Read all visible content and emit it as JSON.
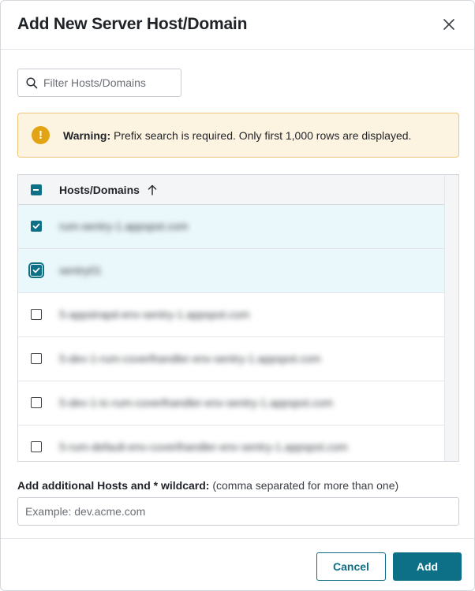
{
  "dialog": {
    "title": "Add New Server Host/Domain",
    "close_icon": "close-icon"
  },
  "filter": {
    "placeholder": "Filter Hosts/Domains",
    "icon": "search-icon"
  },
  "warning": {
    "icon": "exclamation-circle-icon",
    "label": "Warning:",
    "message": " Prefix search is required. Only first 1,000 rows are displayed."
  },
  "table": {
    "header": {
      "column": "Hosts/Domains",
      "sort_icon": "arrow-up-icon",
      "select_all_state": "indeterminate"
    },
    "rows": [
      {
        "host": "rum-sentry-1.appspot.com",
        "checked": true
      },
      {
        "host": "sentry01",
        "checked": true
      },
      {
        "host": "5-appstrapd-env-sentry-1.appspot.com",
        "checked": false
      },
      {
        "host": "5-dev-1-rum-coverlhandler-env-sentry-1.appspot.com",
        "checked": false
      },
      {
        "host": "5-dev-1-tc-rum-coverlhandler-env-sentry-1.appspot.com",
        "checked": false
      },
      {
        "host": "5-rum-default-env-coverlhandler-env-sentry-1.appspot.com",
        "checked": false
      }
    ]
  },
  "additional": {
    "label": "Add additional Hosts and * wildcard:",
    "hint": " (comma separated for more than one)",
    "placeholder": "Example: dev.acme.com"
  },
  "footer": {
    "cancel_label": "Cancel",
    "add_label": "Add"
  },
  "colors": {
    "accent": "#0d7087",
    "selected_row": "#ebf8fb",
    "warning_bg": "#fdf3e1",
    "warning_border": "#efc77b",
    "warning_icon": "#e2a413"
  }
}
